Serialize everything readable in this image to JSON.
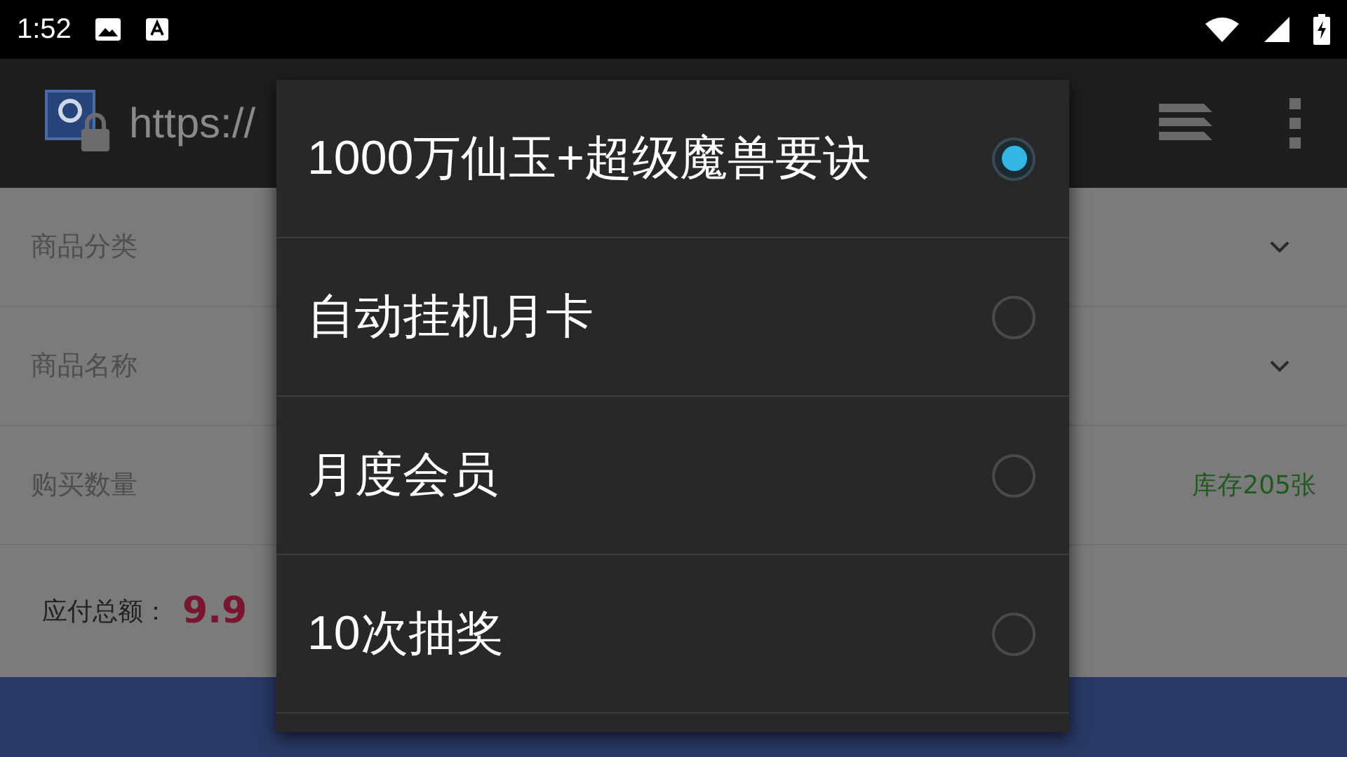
{
  "status_bar": {
    "time": "1:52"
  },
  "toolbar": {
    "url": "https://"
  },
  "form": {
    "rows": [
      {
        "kind": "select",
        "label": "商品分类"
      },
      {
        "kind": "select",
        "label": "商品名称"
      },
      {
        "kind": "stock",
        "label": "购买数量",
        "stock": "库存205张"
      }
    ],
    "total": {
      "label": "应付总额：",
      "amount": "9.9"
    }
  },
  "dialog": {
    "options": [
      {
        "label": "1000万仙玉+超级魔兽要诀",
        "selected": true
      },
      {
        "label": "自动挂机月卡",
        "selected": false
      },
      {
        "label": "月度会员",
        "selected": false
      },
      {
        "label": "10次抽奖",
        "selected": false
      }
    ]
  }
}
